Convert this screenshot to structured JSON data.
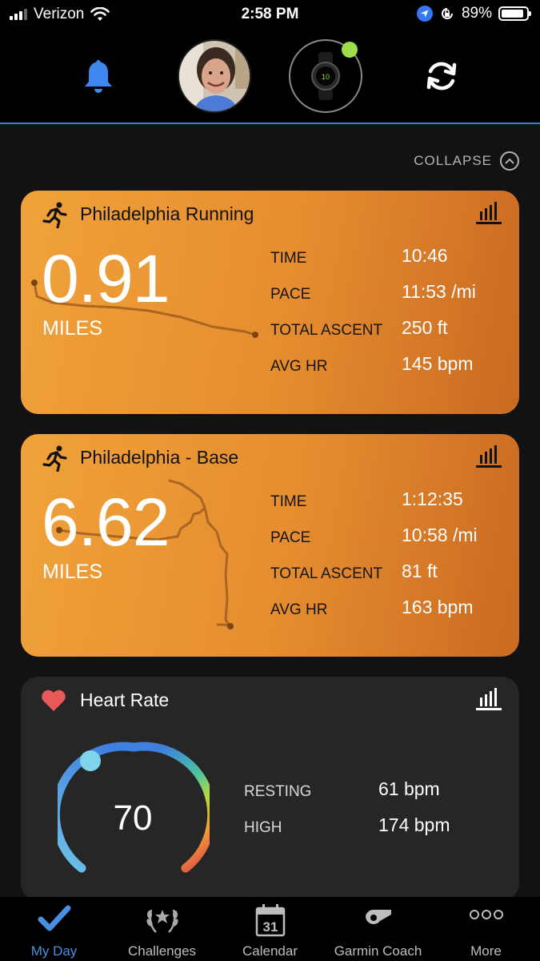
{
  "status_bar": {
    "carrier": "Verizon",
    "time": "2:58 PM",
    "battery": "89%",
    "battery_level": 0.89
  },
  "header": {
    "icons": [
      "bell-icon",
      "profile-avatar",
      "watch-device",
      "sync-icon"
    ],
    "collapse_label": "COLLAPSE"
  },
  "cards": [
    {
      "title": "Philadelphia Running",
      "distance": "0.91",
      "distance_unit": "MILES",
      "stats": [
        {
          "label": "TIME",
          "value": "10:46"
        },
        {
          "label": "PACE",
          "value": "11:53 /mi"
        },
        {
          "label": "TOTAL ASCENT",
          "value": "250 ft"
        },
        {
          "label": "AVG HR",
          "value": "145 bpm"
        }
      ]
    },
    {
      "title": "Philadelphia - Base",
      "distance": "6.62",
      "distance_unit": "MILES",
      "stats": [
        {
          "label": "TIME",
          "value": "1:12:35"
        },
        {
          "label": "PACE",
          "value": "10:58 /mi"
        },
        {
          "label": "TOTAL ASCENT",
          "value": "81 ft"
        },
        {
          "label": "AVG HR",
          "value": "163 bpm"
        }
      ]
    }
  ],
  "heart_rate": {
    "title": "Heart Rate",
    "current": "70",
    "stats": [
      {
        "label": "RESTING",
        "value": "61 bpm"
      },
      {
        "label": "HIGH",
        "value": "174 bpm"
      }
    ]
  },
  "tabs": [
    {
      "label": "My Day",
      "icon": "checkmark-icon",
      "active": true
    },
    {
      "label": "Challenges",
      "icon": "laurel-icon",
      "active": false
    },
    {
      "label": "Calendar",
      "icon": "calendar-icon",
      "active": false,
      "date": "31"
    },
    {
      "label": "Garmin Coach",
      "icon": "whistle-icon",
      "active": false
    },
    {
      "label": "More",
      "icon": "more-dots-icon",
      "active": false
    }
  ],
  "colors": {
    "accent": "#4a8fe0",
    "card_orange": "#e58c2f",
    "heart": "#e85a5a"
  }
}
